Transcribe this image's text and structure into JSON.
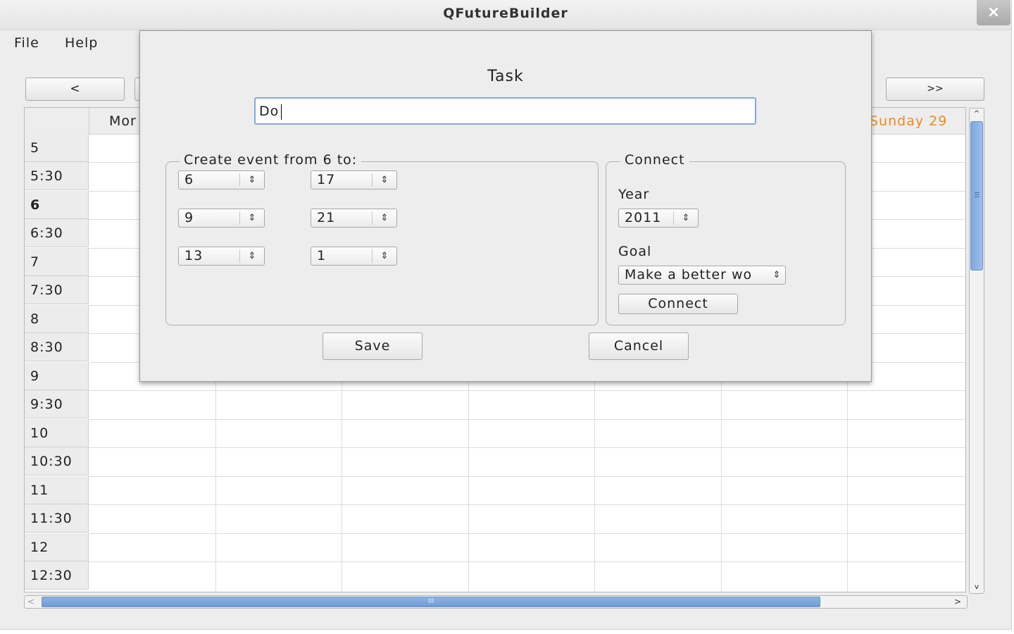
{
  "window": {
    "title": "QFutureBuilder",
    "close_glyph": "×"
  },
  "menu": {
    "items": [
      "File",
      "Help"
    ]
  },
  "nav": {
    "prev_label": "<",
    "next_label": ">>"
  },
  "calendar": {
    "col_headers": [
      "Mor",
      "Sunday 29"
    ],
    "today_color": "#f08a1a",
    "rows": [
      "5",
      "5:30",
      "6",
      "6:30",
      "7",
      "7:30",
      "8",
      "8:30",
      "9",
      "9:30",
      "10",
      "10:30",
      "11",
      "11:30",
      "12",
      "12:30"
    ],
    "bold_row": "6"
  },
  "dialog": {
    "task_label": "Task",
    "task_value": "Do",
    "event_group": {
      "title": "Create event from 6 to:",
      "spins_left": [
        "6",
        "9",
        "13"
      ],
      "spins_right": [
        "17",
        "21",
        "1"
      ]
    },
    "connect_group": {
      "title": "Connect",
      "year_label": "Year",
      "year_value": "2011",
      "goal_label": "Goal",
      "goal_value": "Make a better wo",
      "connect_button": "Connect"
    },
    "save_button": "Save",
    "cancel_button": "Cancel"
  },
  "scrollbars": {
    "grip": "III",
    "left_arrow": "<",
    "right_arrow": ">"
  }
}
